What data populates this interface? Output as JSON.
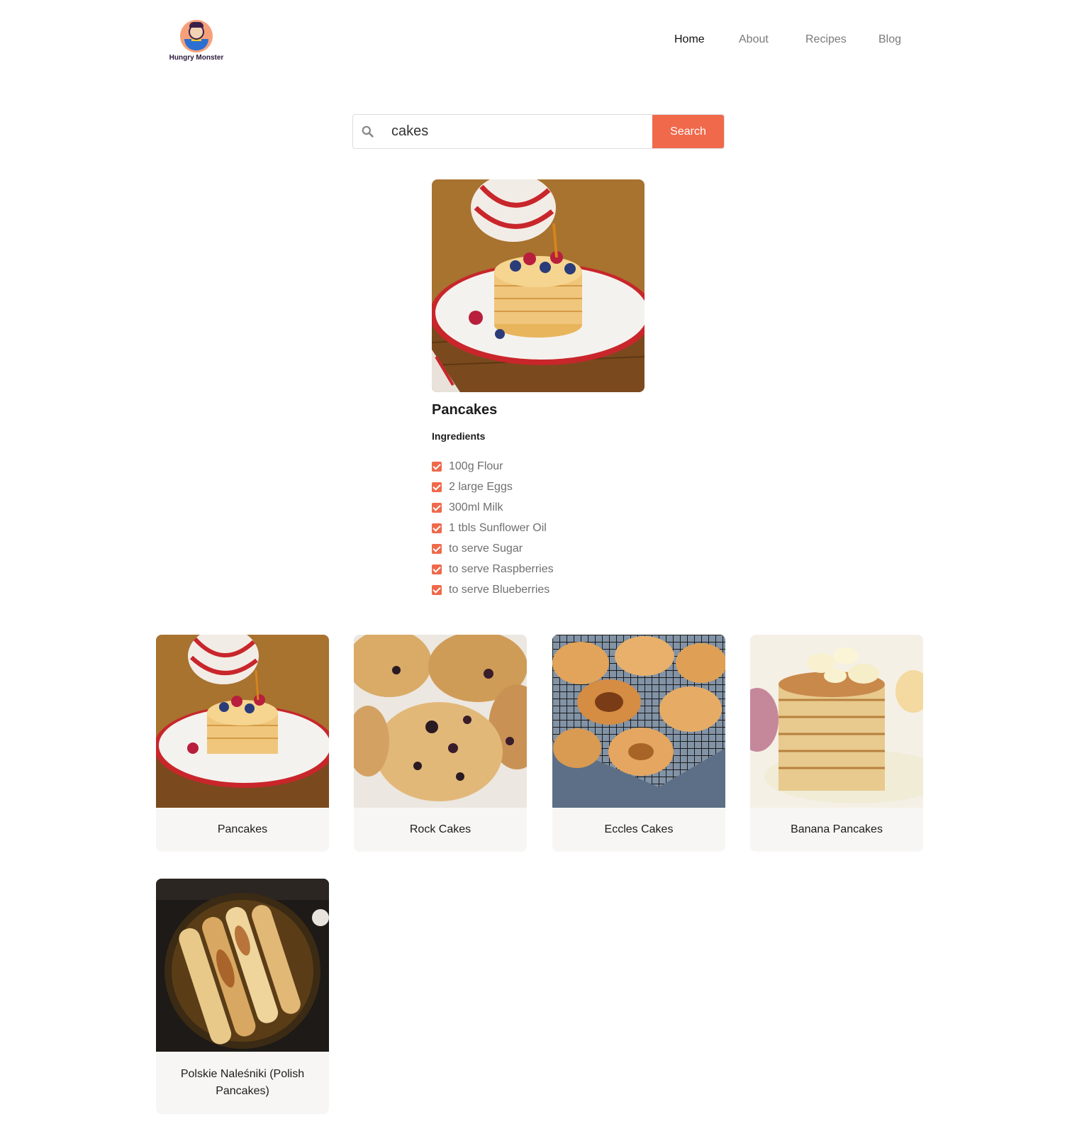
{
  "brand": {
    "name": "Hungry Monster"
  },
  "nav": {
    "items": [
      {
        "label": "Home",
        "active": true
      },
      {
        "label": "About",
        "active": false
      },
      {
        "label": "Recipes",
        "active": false
      },
      {
        "label": "Blog",
        "active": false
      }
    ]
  },
  "search": {
    "value": "cakes",
    "button_label": "Search"
  },
  "featured": {
    "title": "Pancakes",
    "ingredients_label": "Ingredients",
    "ingredients": [
      "100g Flour",
      "2 large Eggs",
      "300ml Milk",
      "1 tbls Sunflower Oil",
      "to serve Sugar",
      "to serve Raspberries",
      "to serve Blueberries"
    ]
  },
  "results": [
    {
      "name": "Pancakes"
    },
    {
      "name": "Rock Cakes"
    },
    {
      "name": "Eccles Cakes"
    },
    {
      "name": "Banana Pancakes"
    },
    {
      "name": "Polskie Naleśniki (Polish Pancakes)"
    }
  ],
  "colors": {
    "accent": "#f0694b",
    "card_bg": "#f7f6f4",
    "nav_muted": "#7a7a7a"
  }
}
